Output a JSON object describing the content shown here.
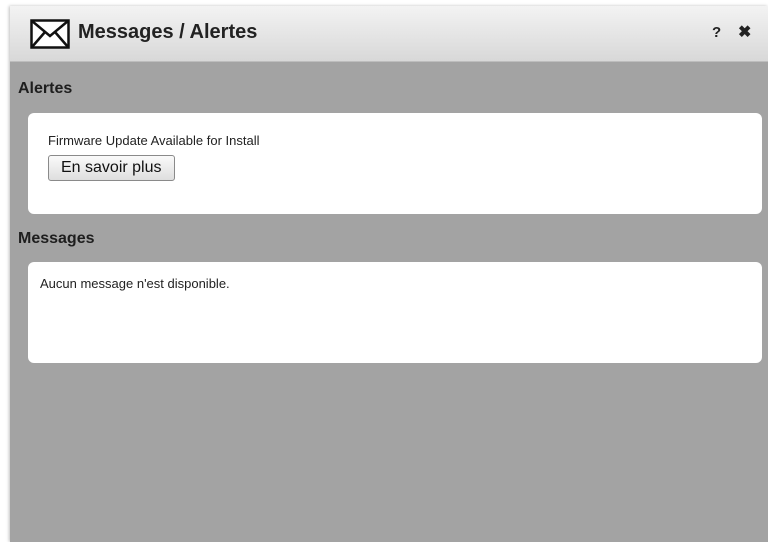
{
  "dialog": {
    "title": "Messages / Alertes",
    "icon": "envelope-icon",
    "help_label": "?",
    "close_label": "✖"
  },
  "alerts": {
    "heading": "Alertes",
    "items": [
      {
        "text": "Firmware Update Available for Install",
        "button_label": "En savoir plus"
      }
    ]
  },
  "messages": {
    "heading": "Messages",
    "empty_text": "Aucun message n'est disponible."
  }
}
